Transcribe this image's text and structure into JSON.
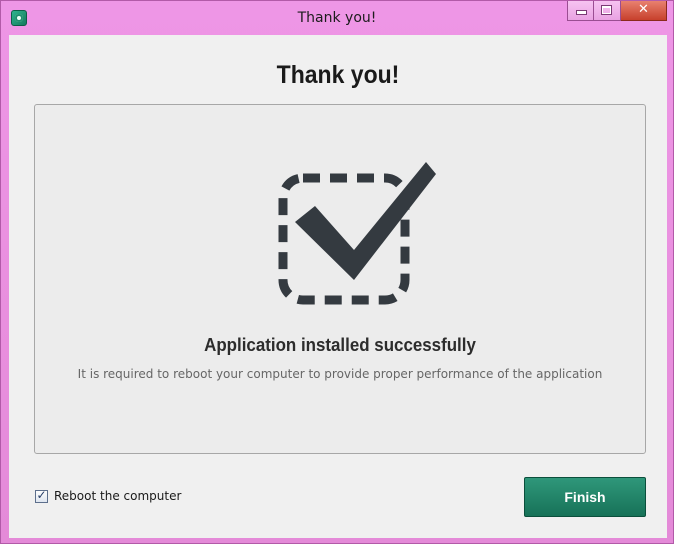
{
  "window": {
    "title": "Thank you!",
    "close_glyph": "✕",
    "icons": {
      "app": "app-icon",
      "minimize": "minimize-icon",
      "maximize": "maximize-icon",
      "close": "close-icon",
      "success": "checkmark-icon"
    }
  },
  "content": {
    "heading": "Thank you!",
    "success_title": "Application installed successfully",
    "success_note": "It is required to reboot your computer to provide proper performance of the application"
  },
  "footer": {
    "reboot_label": "Reboot the computer",
    "reboot_checked": true,
    "finish_label": "Finish"
  },
  "colors": {
    "frame": "#e48ad8",
    "accent": "#177258",
    "icon": "#343a40"
  }
}
